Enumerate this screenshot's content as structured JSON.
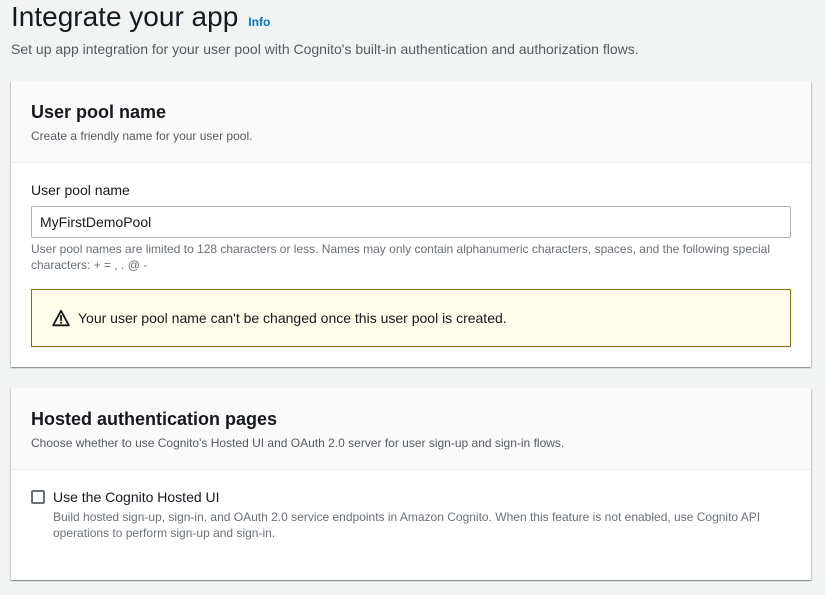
{
  "header": {
    "title": "Integrate your app",
    "info_link": "Info",
    "description": "Set up app integration for your user pool with Cognito's built-in authentication and authorization flows."
  },
  "user_pool_section": {
    "title": "User pool name",
    "description": "Create a friendly name for your user pool.",
    "field_label": "User pool name",
    "field_value": "MyFirstDemoPool",
    "constraint_text": "User pool names are limited to 128 characters or less. Names may only contain alphanumeric characters, spaces, and the following special characters: + = , . @ -",
    "alert": {
      "icon": "warning-icon",
      "text": "Your user pool name can't be changed once this user pool is created."
    }
  },
  "hosted_auth_section": {
    "title": "Hosted authentication pages",
    "description": "Choose whether to use Cognito's Hosted UI and OAuth 2.0 server for user sign-up and sign-in flows.",
    "checkbox_label": "Use the Cognito Hosted UI",
    "checkbox_checked": false,
    "checkbox_description": "Build hosted sign-up, sign-in, and OAuth 2.0 service endpoints in Amazon Cognito. When this feature is not enabled, use Cognito API operations to perform sign-up and sign-in."
  },
  "colors": {
    "link": "#0073bb",
    "warning_border": "#906806",
    "warning_background": "#fffce9",
    "page_background": "#f2f3f3"
  }
}
